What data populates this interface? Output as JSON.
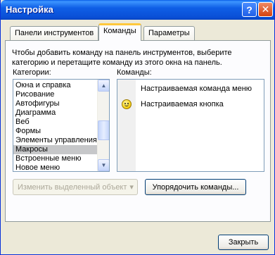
{
  "window": {
    "title": "Настройка",
    "help_button": "?",
    "close_button": "✕"
  },
  "tabs": [
    {
      "label": "Панели инструментов",
      "active": false
    },
    {
      "label": "Команды",
      "active": true
    },
    {
      "label": "Параметры",
      "active": false
    }
  ],
  "description": "Чтобы добавить команду на панель инструментов, выберите категорию и перетащите команду из этого окна на панель.",
  "categories": {
    "label": "Категории:",
    "items": [
      "Окна и справка",
      "Рисование",
      "Автофигуры",
      "Диаграмма",
      "Веб",
      "Формы",
      "Элементы управления",
      "Макросы",
      "Встроенные меню",
      "Новое меню"
    ],
    "selected": "Макросы"
  },
  "commands": {
    "label": "Команды:",
    "items": [
      {
        "label": "Настраиваемая команда меню",
        "icon": ""
      },
      {
        "label": "Настраиваемая кнопка",
        "icon": "smiley-icon"
      }
    ]
  },
  "buttons": {
    "modify_selection": "Изменить выделенный объект",
    "modify_arrow": "▾",
    "rearrange": "Упорядочить команды...",
    "close": "Закрыть"
  },
  "colors": {
    "title_bar": "#0a5ee8",
    "active_tab_highlight": "#ffc83c",
    "dialog_background": "#ece9d8",
    "selection": "#c6c7c9"
  }
}
